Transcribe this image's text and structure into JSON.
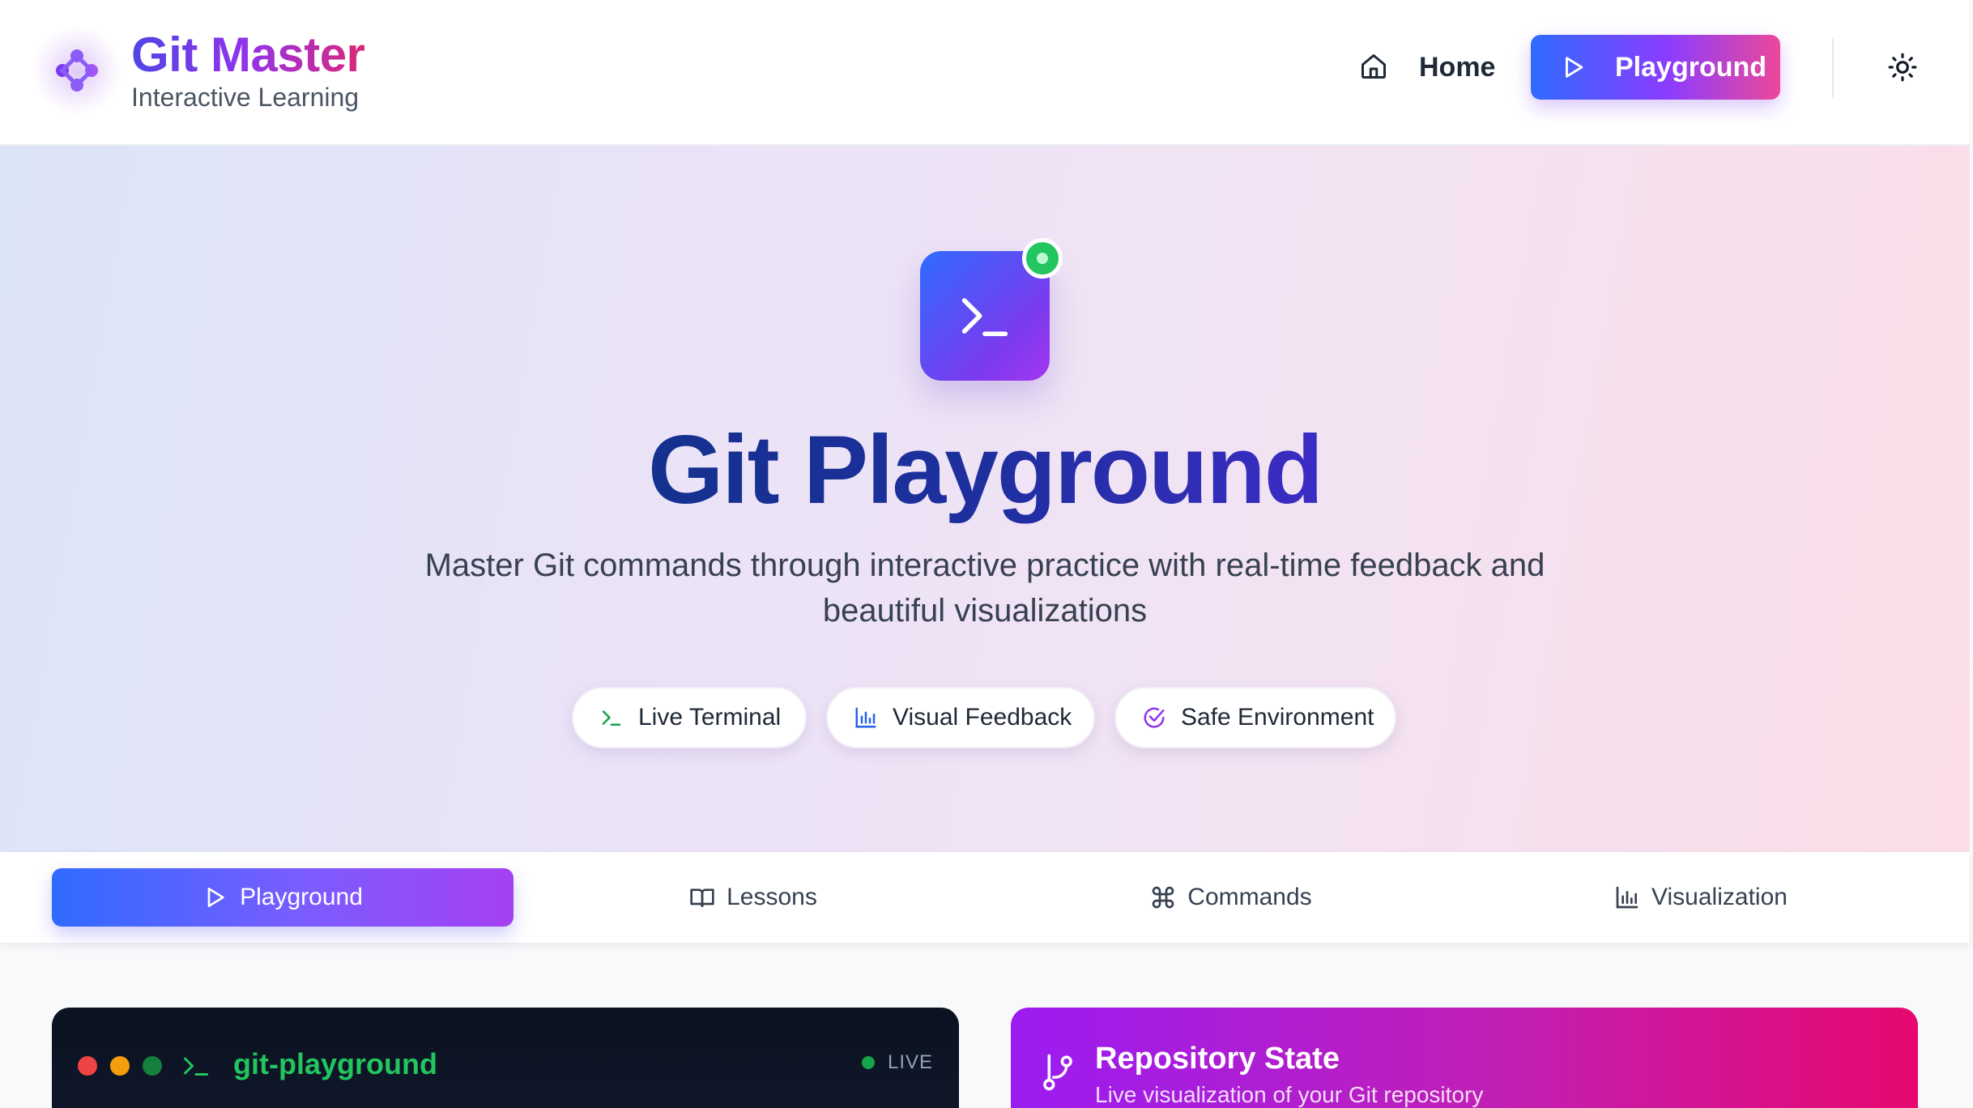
{
  "header": {
    "brand_title": "Git Master",
    "brand_subtitle": "Interactive Learning",
    "nav": {
      "home_label": "Home",
      "playground_label": "Playground"
    }
  },
  "hero": {
    "title": "Git Playground",
    "subtitle_line1": "Master Git commands through interactive practice with real-time feedback and",
    "subtitle_line2": "beautiful visualizations",
    "chips": [
      {
        "label": "Live Terminal",
        "icon": "terminal-icon"
      },
      {
        "label": "Visual Feedback",
        "icon": "bar-chart-icon"
      },
      {
        "label": "Safe Environment",
        "icon": "check-circle-icon"
      }
    ]
  },
  "tabs": [
    {
      "label": "Playground",
      "icon": "play-icon",
      "active": true
    },
    {
      "label": "Lessons",
      "icon": "book-icon",
      "active": false
    },
    {
      "label": "Commands",
      "icon": "command-icon",
      "active": false
    },
    {
      "label": "Visualization",
      "icon": "bar-chart-icon",
      "active": false
    }
  ],
  "terminal": {
    "title": "git-playground",
    "status": "LIVE"
  },
  "repository": {
    "title": "Repository State",
    "subtitle": "Live visualization of your Git repository"
  },
  "colors": {
    "brand_gradient_start": "#2f6bff",
    "brand_gradient_mid": "#8b3dff",
    "brand_gradient_end": "#ec4899",
    "terminal_bg": "#0f172a",
    "terminal_accent": "#22c55e",
    "repo_gradient_start": "#9b1cf2",
    "repo_gradient_end": "#e6086f"
  }
}
